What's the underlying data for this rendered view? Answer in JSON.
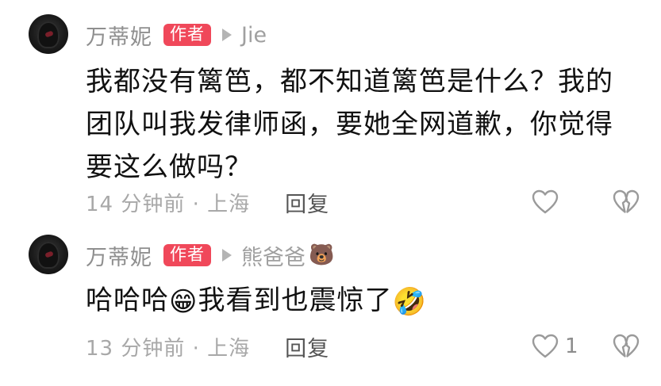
{
  "comments": [
    {
      "username": "万蒂妮",
      "badge": "作者",
      "reply_to": "Jie",
      "reply_to_emoji": "",
      "text": "我都没有篱笆，都不知道篱笆是什么？我的团队叫我发律师函，要她全网道歉，你觉得要这么做吗？",
      "time_location": "14 分钟前 · 上海",
      "reply_label": "回复",
      "like_count": ""
    },
    {
      "username": "万蒂妮",
      "badge": "作者",
      "reply_to": "熊爸爸",
      "reply_to_emoji": "🐻",
      "text_before": "哈哈哈",
      "emoji_grin": "😁",
      "text_middle": "我看到也震惊了",
      "emoji_laugh": "🤣",
      "time_location": "13 分钟前 · 上海",
      "reply_label": "回复",
      "like_count": "1"
    }
  ],
  "colors": {
    "badge_bg": "#f0485a",
    "username": "#8f8f8f",
    "meta_text": "#a8a8a8",
    "icon_stroke": "#9a9a9a"
  }
}
